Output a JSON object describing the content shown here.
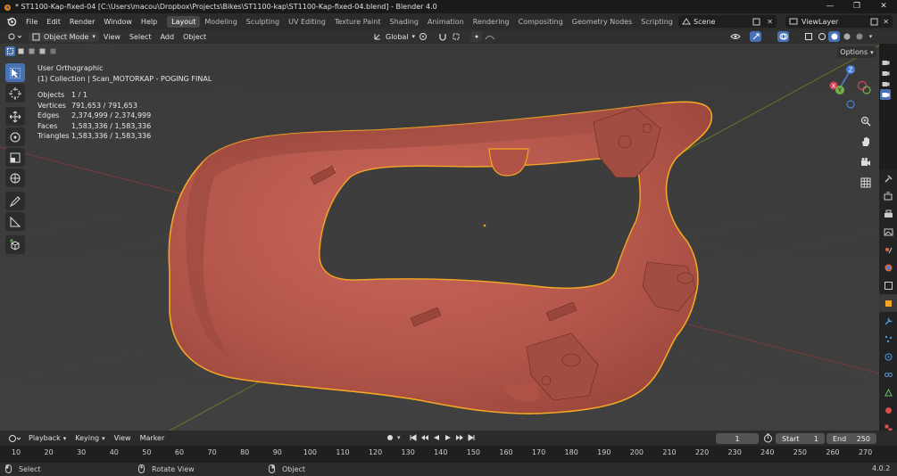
{
  "window": {
    "title": "* ST1100-Kap-fixed-04 [C:\\Users\\macou\\Dropbox\\Projects\\Bikes\\ST1100-kap\\ST1100-Kap-fixed-04.blend] - Blender 4.0",
    "controls": [
      "—",
      "❐",
      "✕"
    ]
  },
  "menubar": {
    "menus": [
      "File",
      "Edit",
      "Render",
      "Window",
      "Help"
    ],
    "workspaces": [
      "Layout",
      "Modeling",
      "Sculpting",
      "UV Editing",
      "Texture Paint",
      "Shading",
      "Animation",
      "Rendering",
      "Compositing",
      "Geometry Nodes",
      "Scripting"
    ],
    "active_workspace": "Layout",
    "add_tab": "+",
    "scene": "Scene",
    "view_layer": "ViewLayer"
  },
  "header3d": {
    "mode": "Object Mode",
    "menus": [
      "View",
      "Select",
      "Add",
      "Object"
    ],
    "transform_orientation": "Global"
  },
  "viewport": {
    "view_name": "User Orthographic",
    "collection_line": "(1) Collection | Scan_MOTORKAP - POGING FINAL",
    "stats": [
      {
        "label": "Objects",
        "value": "1 / 1"
      },
      {
        "label": "Vertices",
        "value": "791,653 / 791,653"
      },
      {
        "label": "Edges",
        "value": "2,374,999 / 2,374,999"
      },
      {
        "label": "Faces",
        "value": "1,583,336 / 1,583,336"
      },
      {
        "label": "Triangles",
        "value": "1,583,336 / 1,583,336"
      }
    ],
    "options_label": "Options",
    "gizmo_labels": {
      "z": "Z",
      "y": "Y",
      "x": "X"
    },
    "colors": {
      "background": "#3d3d3d",
      "mesh": "#b8584a",
      "outline": "#f5a623",
      "x_axis": "#8a3a3a",
      "y_axis": "#6d8a2a",
      "accent": "#4772b3"
    }
  },
  "timeline": {
    "menus": [
      "Playback",
      "Keying",
      "View",
      "Marker"
    ],
    "current_frame": "1",
    "start_label": "Start",
    "start_value": "1",
    "end_label": "End",
    "end_value": "250",
    "ruler_ticks": [
      "10",
      "20",
      "30",
      "40",
      "50",
      "60",
      "70",
      "80",
      "90",
      "100",
      "110",
      "120",
      "130",
      "140",
      "150",
      "160",
      "170",
      "180",
      "190",
      "200",
      "210",
      "220",
      "230",
      "240",
      "250",
      "260",
      "270"
    ]
  },
  "statusbar": {
    "select": "Select",
    "rotate": "Rotate View",
    "object": "Object",
    "version": "4.0.2"
  }
}
